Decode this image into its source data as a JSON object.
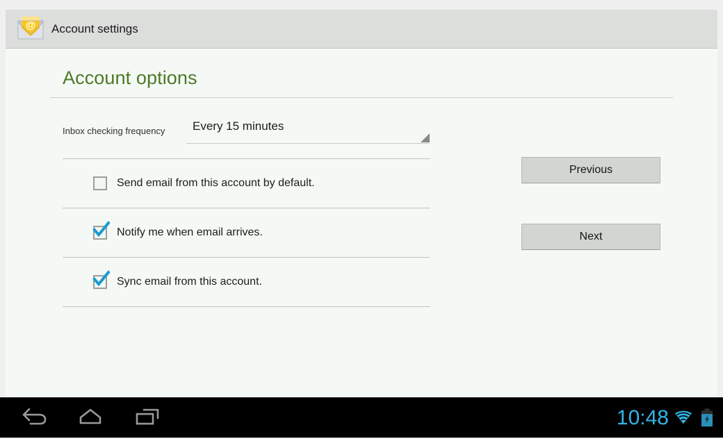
{
  "window": {
    "app_icon": "email-envelope-at-icon",
    "title": "Account settings"
  },
  "content": {
    "page_title": "Account options",
    "spinner": {
      "label": "Inbox checking frequency",
      "value": "Every 15 minutes",
      "arrow_icon": "spinner-dropdown-triangle-icon"
    },
    "checkboxes": [
      {
        "label": "Send email from this account by default.",
        "checked": false,
        "name": "send-email-by-default"
      },
      {
        "label": "Notify me when email arrives.",
        "checked": true,
        "name": "notify-on-email"
      },
      {
        "label": "Sync email from this account.",
        "checked": true,
        "name": "sync-email"
      }
    ],
    "buttons": {
      "previous": "Previous",
      "next": "Next"
    }
  },
  "navbar": {
    "back_icon": "back-arrow-icon",
    "home_icon": "home-icon",
    "recents_icon": "recent-apps-icon",
    "clock": "10:48",
    "wifi_icon": "wifi-icon",
    "battery_icon": "battery-charging-icon"
  },
  "colors": {
    "accent_green": "#4c7a28",
    "accent_blue": "#33b5e5",
    "checkbox_blue": "#1a9ad0",
    "action_bar": "#dcdedc",
    "content_bg": "#f5f9f5"
  }
}
